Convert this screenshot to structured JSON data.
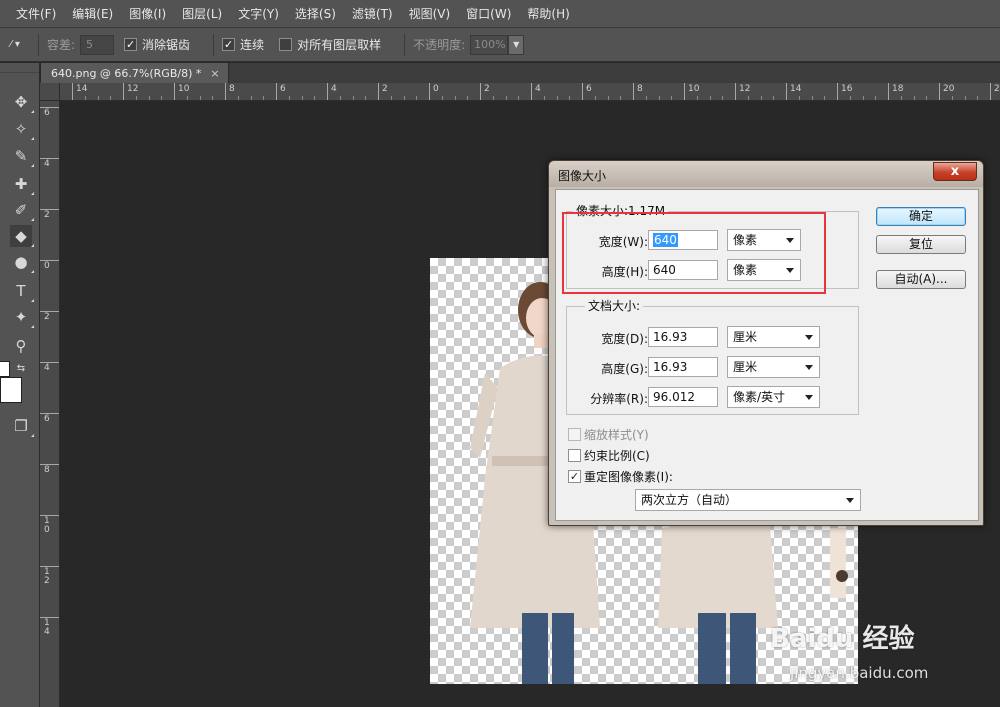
{
  "menu": [
    "文件(F)",
    "编辑(E)",
    "图像(I)",
    "图层(L)",
    "文字(Y)",
    "选择(S)",
    "滤镜(T)",
    "视图(V)",
    "窗口(W)",
    "帮助(H)"
  ],
  "options": {
    "tolerance_label": "容差:",
    "tolerance_value": "5",
    "antialias_label": "消除锯齿",
    "contiguous_label": "连续",
    "sample_all_label": "对所有图层取样",
    "opacity_label": "不透明度:",
    "opacity_value": "100%"
  },
  "document_tab": {
    "title": "640.png @ 66.7%(RGB/8) *",
    "close": "×"
  },
  "ruler_h": [
    "14",
    "12",
    "10",
    "8",
    "6",
    "4",
    "2",
    "0",
    "2",
    "4",
    "6",
    "8",
    "10",
    "12",
    "14",
    "16",
    "18",
    "20",
    "22"
  ],
  "ruler_v": [
    "6",
    "4",
    "2",
    "0",
    "2",
    "4",
    "6",
    "8",
    "1 0",
    "1 2",
    "1 4"
  ],
  "dialog": {
    "title": "图像大小",
    "close": "x",
    "pixel_dimensions": {
      "legend": "像素大小:1.17M",
      "width_label": "宽度(W):",
      "width_value": "640",
      "width_unit": "像素",
      "height_label": "高度(H):",
      "height_value": "640",
      "height_unit": "像素"
    },
    "document_size": {
      "legend": "文档大小:",
      "width_label": "宽度(D):",
      "width_value": "16.93",
      "width_unit": "厘米",
      "height_label": "高度(G):",
      "height_value": "16.93",
      "height_unit": "厘米",
      "resolution_label": "分辨率(R):",
      "resolution_value": "96.012",
      "resolution_unit": "像素/英寸"
    },
    "scale_styles_label": "缩放样式(Y)",
    "constrain_label": "约束比例(C)",
    "resample_label": "重定图像像素(I):",
    "resample_method": "两次立方（自动）",
    "ok_label": "确定",
    "reset_label": "复位",
    "auto_label": "自动(A)..."
  },
  "watermark": {
    "brand": "Baidu 经验",
    "url": "jingyan.baidu.com"
  }
}
